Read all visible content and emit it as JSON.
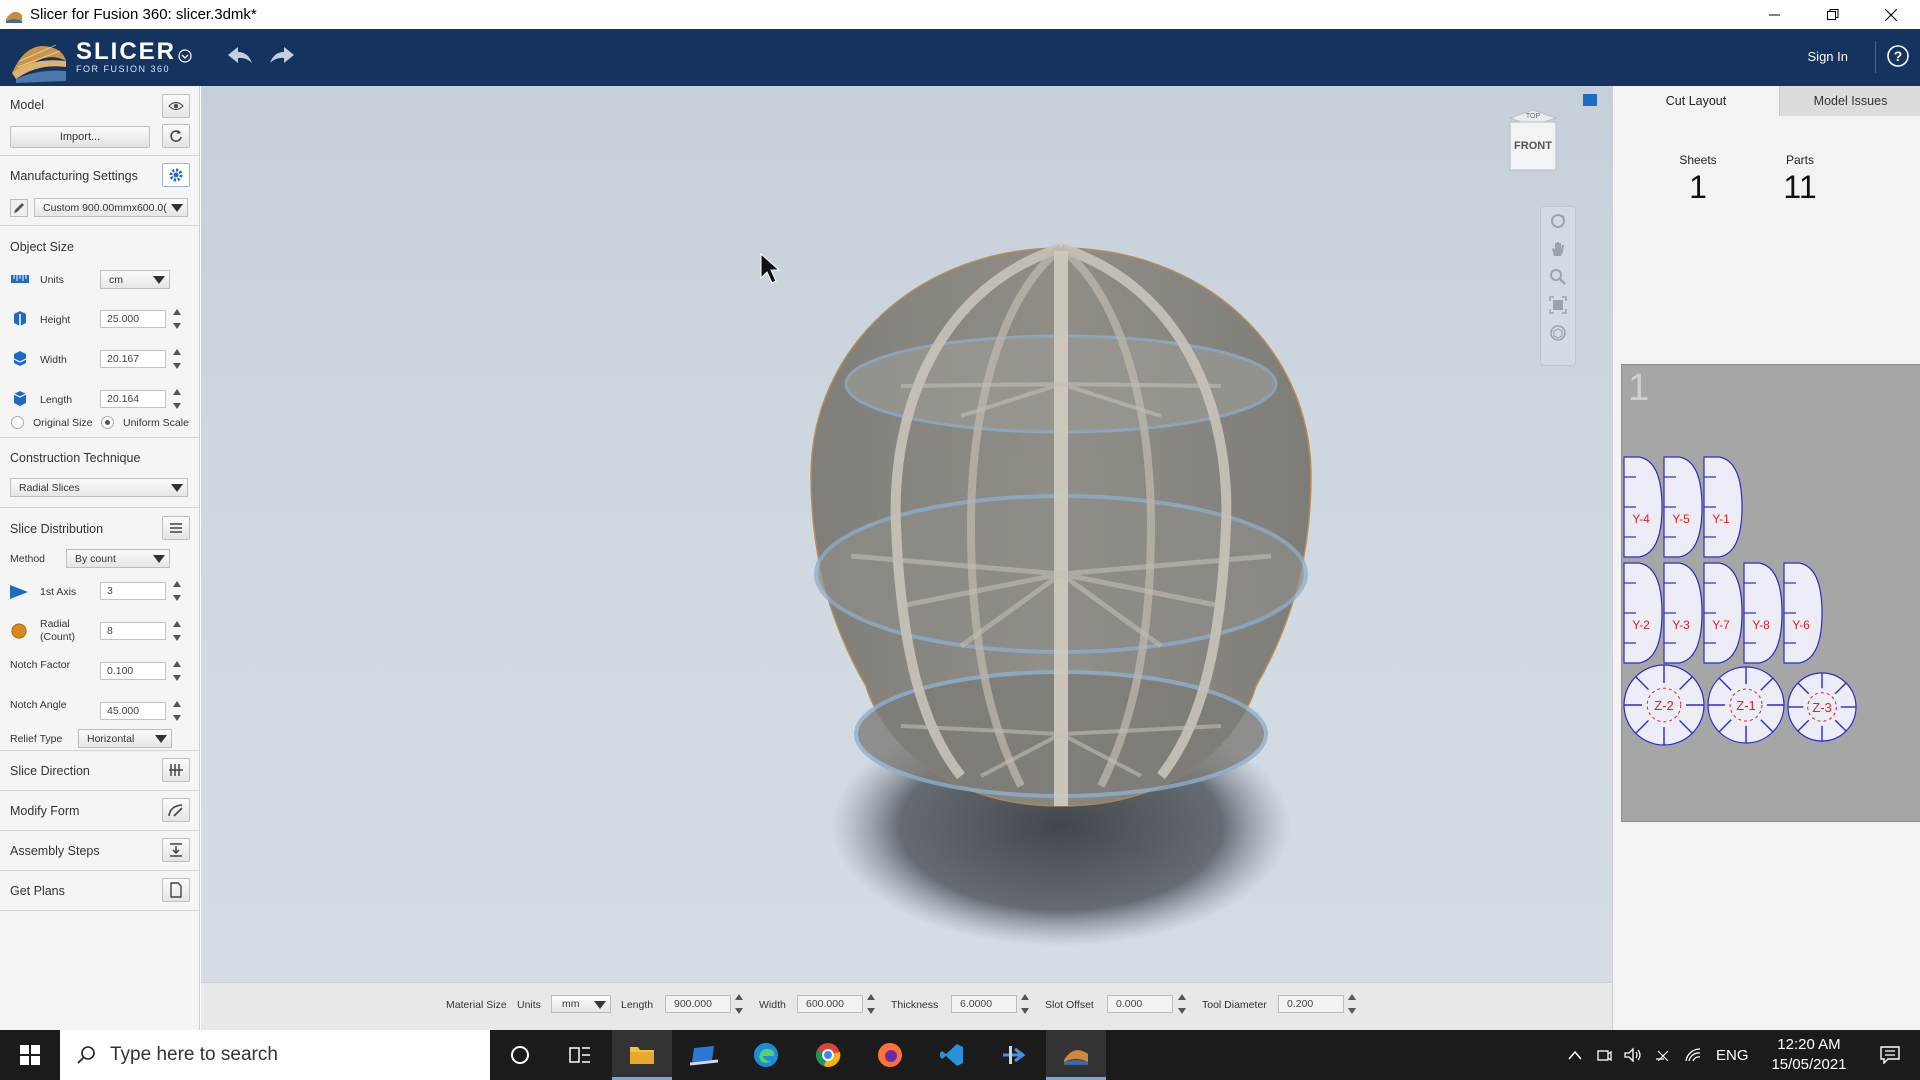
{
  "window": {
    "title": "Slicer for Fusion 360: slicer.3dmk*"
  },
  "header": {
    "brand_main": "SLICER",
    "brand_sub": "FOR FUSION 360",
    "sign_in": "Sign In",
    "help": "?"
  },
  "left": {
    "model_title": "Model",
    "import_label": "Import...",
    "manufacturing_title": "Manufacturing Settings",
    "manufacturing_preset": "Custom 900.00mmx600.0(",
    "object_size_title": "Object Size",
    "units_label": "Units",
    "units_value": "cm",
    "height_label": "Height",
    "height_value": "25.000",
    "width_label": "Width",
    "width_value": "20.167",
    "length_label": "Length",
    "length_value": "20.164",
    "original_size": "Original Size",
    "uniform_scale": "Uniform Scale",
    "construction_title": "Construction Technique",
    "construction_value": "Radial Slices",
    "slice_dist_title": "Slice Distribution",
    "method_label": "Method",
    "method_value": "By count",
    "first_axis_label": "1st Axis",
    "first_axis_value": "3",
    "radial_label_1": "Radial",
    "radial_label_2": "(Count)",
    "radial_value": "8",
    "notch_factor_label": "Notch Factor",
    "notch_factor_value": "0.100",
    "notch_angle_label": "Notch Angle",
    "notch_angle_value": "45.000",
    "relief_label": "Relief Type",
    "relief_value": "Horizontal",
    "slice_direction": "Slice Direction",
    "modify_form": "Modify Form",
    "assembly_steps": "Assembly Steps",
    "get_plans": "Get Plans"
  },
  "viewcube": {
    "top": "TOP",
    "front": "FRONT"
  },
  "bottom": {
    "material_size": "Material Size",
    "units_label": "Units",
    "units_value": "mm",
    "length_label": "Length",
    "length_value": "900.000",
    "width_label": "Width",
    "width_value": "600.000",
    "thickness_label": "Thickness",
    "thickness_value": "6.0000",
    "slot_offset_label": "Slot Offset",
    "slot_offset_value": "0.000",
    "tool_diameter_label": "Tool Diameter",
    "tool_diameter_value": "0.200"
  },
  "right": {
    "tab_cut_layout": "Cut Layout",
    "tab_model_issues": "Model Issues",
    "sheets_label": "Sheets",
    "sheets_value": "1",
    "parts_label": "Parts",
    "parts_value": "11",
    "sheet_number": "1",
    "parts": [
      {
        "label": "Y-4"
      },
      {
        "label": "Y-5"
      },
      {
        "label": "Y-1"
      },
      {
        "label": "Y-2"
      },
      {
        "label": "Y-3"
      },
      {
        "label": "Y-7"
      },
      {
        "label": "Y-8"
      },
      {
        "label": "Y-6"
      },
      {
        "label": "Z-2"
      },
      {
        "label": "Z-1"
      },
      {
        "label": "Z-3"
      }
    ]
  },
  "taskbar": {
    "search_placeholder": "Type here to search",
    "language": "ENG",
    "time": "12:20 AM",
    "date": "15/05/2021"
  },
  "colors": {
    "header_bg": "#14335f",
    "accent": "#1e6bc5",
    "part_outline": "#2a2ad0",
    "part_label": "#e02020"
  }
}
